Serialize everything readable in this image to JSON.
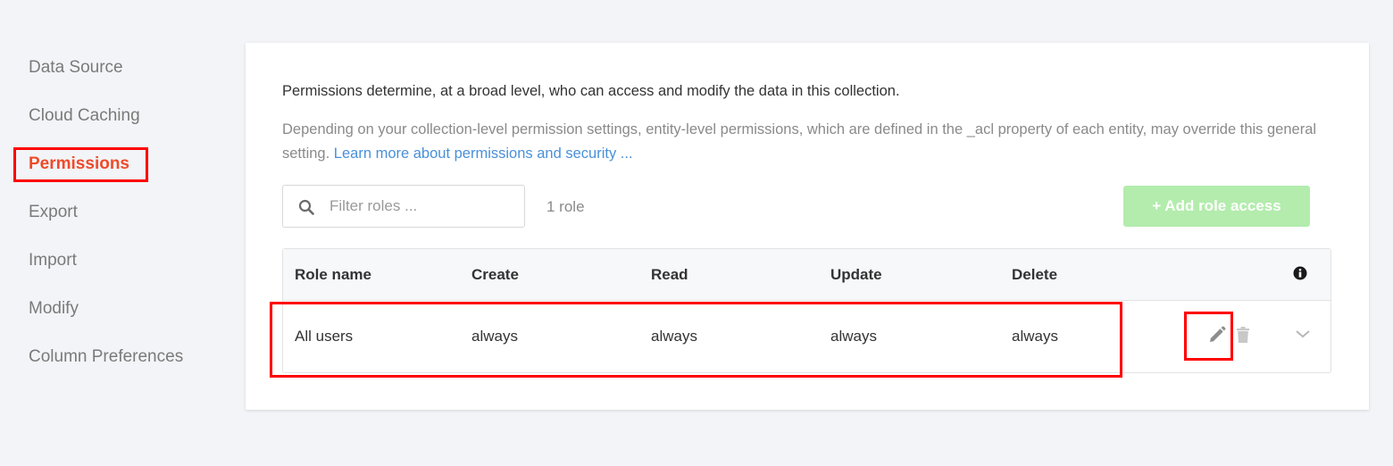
{
  "sidebar": {
    "items": [
      {
        "label": "Data Source"
      },
      {
        "label": "Cloud Caching"
      },
      {
        "label": "Permissions",
        "active": true
      },
      {
        "label": "Export"
      },
      {
        "label": "Import"
      },
      {
        "label": "Modify"
      },
      {
        "label": "Column Preferences"
      }
    ]
  },
  "main": {
    "intro": "Permissions determine, at a broad level, who can access and modify the data in this collection.",
    "description": "Depending on your collection-level permission settings, entity-level permissions, which are defined in the _acl property of each entity, may override this general setting.",
    "learn_more_link": "Learn more about permissions and security ...",
    "filter": {
      "placeholder": "Filter roles ...",
      "value": ""
    },
    "role_count": "1 role",
    "add_button_label": "+ Add role access",
    "table": {
      "columns": [
        "Role name",
        "Create",
        "Read",
        "Update",
        "Delete"
      ],
      "rows": [
        {
          "role": "All users",
          "create": "always",
          "read": "always",
          "update": "always",
          "delete": "always"
        }
      ]
    }
  },
  "colors": {
    "accent_active": "#ef4b2a",
    "link": "#4a90d9",
    "add_button": "#b3ecad",
    "highlight_annotation": "#ff0000"
  },
  "icons": [
    "search-icon",
    "info-icon",
    "pencil-icon",
    "trash-icon",
    "chevron-down-icon"
  ]
}
